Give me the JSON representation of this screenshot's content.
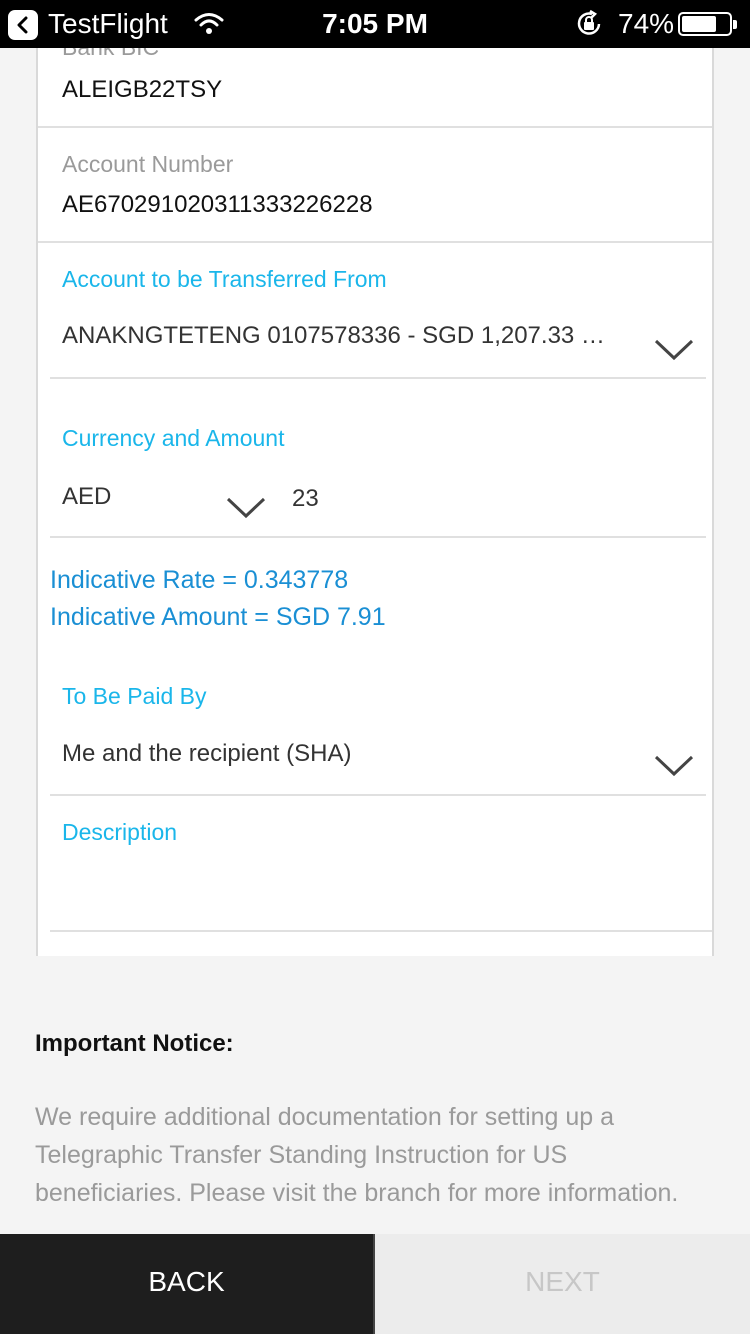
{
  "status_bar": {
    "app": "TestFlight",
    "time": "7:05 PM",
    "battery": "74%",
    "battery_level": 0.74
  },
  "form": {
    "bank_bic": {
      "label": "Bank BIC",
      "value": "ALEIGB22TSY"
    },
    "account_number": {
      "label": "Account Number",
      "value": "AE670291020311333226228"
    },
    "transfer_from": {
      "label": "Account to be Transferred From",
      "value": "ANAKNGTETENG 0107578336 - SGD 1,207.33 …"
    },
    "currency_amount": {
      "label": "Currency and Amount",
      "currency": "AED",
      "amount": "23"
    },
    "indicative_rate": "Indicative Rate = 0.343778",
    "indicative_amount": "Indicative Amount = SGD 7.91",
    "paid_by": {
      "label": "To Be Paid By",
      "value": "Me and the recipient (SHA)"
    },
    "description": {
      "label": "Description",
      "value": ""
    }
  },
  "notice": {
    "title": "Important Notice:",
    "body": "We require additional documentation for setting up a Telegraphic Transfer Standing Instruction for US beneficiaries. Please visit the branch for more information."
  },
  "buttons": {
    "back": "BACK",
    "next": "NEXT"
  },
  "colors": {
    "accent": "#1ab6ea",
    "rate_text": "#1a8fd4",
    "back_bg": "#1e1e1e",
    "next_bg": "#ececec"
  },
  "icons": [
    "back-arrow-icon",
    "wifi-icon",
    "orientation-lock-icon",
    "battery-icon",
    "chevron-down-icon"
  ]
}
